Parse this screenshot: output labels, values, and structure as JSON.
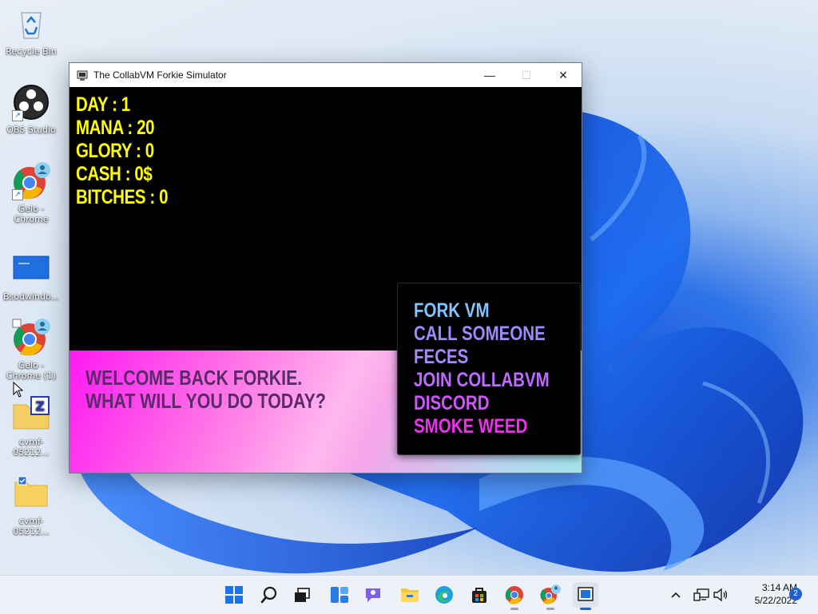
{
  "desktop": {
    "icons": [
      {
        "label": "Recycle Bin"
      },
      {
        "label": "OBS Studio"
      },
      {
        "label": "Gelo - Chrome"
      },
      {
        "label": "Bsodwindo..."
      },
      {
        "label": "Gelo - Chrome (1)"
      },
      {
        "label": "cvmf-05212..."
      },
      {
        "label": "cvmf-05212..."
      }
    ]
  },
  "window": {
    "title": "The CollabVM Forkie Simulator",
    "controls": {
      "minimize": "—",
      "maximize": "☐",
      "close": "✕"
    }
  },
  "game": {
    "stats": [
      "DAY : 1",
      "MANA : 20",
      "GLORY : 0",
      "CASH : 0$",
      "BITCHES : 0"
    ],
    "welcome": [
      "WELCOME BACK FORKIE.",
      "WHAT WILL YOU DO TODAY?"
    ],
    "menu": [
      {
        "label": "FORK VM",
        "color": "#7fc4ff"
      },
      {
        "label": "CALL SOMEONE",
        "color": "#9a8cff"
      },
      {
        "label": "FECES",
        "color": "#a888ff"
      },
      {
        "label": "JOIN COLLABVM",
        "color": "#bb6cff"
      },
      {
        "label": "DISCORD",
        "color": "#cf56ff"
      },
      {
        "label": "SMOKE WEED",
        "color": "#f030f0"
      }
    ],
    "colors": {
      "stats": "#ffff00",
      "welcome": "#5a2a6a"
    }
  },
  "taskbar": {
    "apps": [
      "start-icon",
      "search-icon",
      "task-view-icon",
      "widgets-icon",
      "chat-icon",
      "file-explorer-icon",
      "edge-icon",
      "store-icon",
      "chrome-icon",
      "chrome-profile-icon",
      "forkie-app-icon"
    ],
    "clock": {
      "time": "3:14 AM",
      "date": "5/22/2022"
    },
    "notifications": "2"
  }
}
